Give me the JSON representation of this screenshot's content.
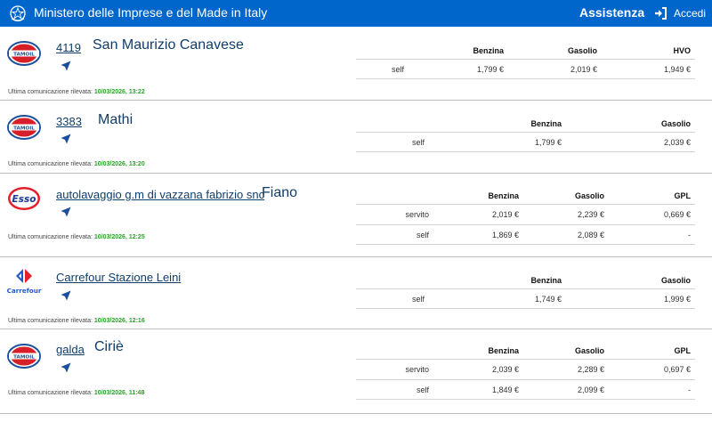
{
  "header": {
    "title": "Ministero delle Imprese e del Made in Italy",
    "help_label": "Assistenza",
    "login_label": "Accedi",
    "emblem_icon": "italian-republic-emblem-icon",
    "login_icon": "sign-in-icon"
  },
  "colors": {
    "header_bg": "#0066cc",
    "link_text": "#0f3d6b",
    "timestamp": "#2ca02c"
  },
  "stations": [
    {
      "brand": "tamoil",
      "code": "4119",
      "city": "San Maurizio Canavese",
      "fuels": [
        "Benzina",
        "Gasolio",
        "HVO"
      ],
      "rows": [
        {
          "service": "self",
          "prices": [
            "1,799 €",
            "2,019 €",
            "1,949 €"
          ]
        }
      ],
      "last_comm_label": "Ultima comunicazione rilevata:",
      "last_comm_time": "10/03/2026, 13:22"
    },
    {
      "brand": "tamoil",
      "code": "3383",
      "city": "Mathi",
      "fuels": [
        "Benzina",
        "Gasolio"
      ],
      "rows": [
        {
          "service": "self",
          "prices": [
            "1,799 €",
            "2,039 €"
          ]
        }
      ],
      "last_comm_label": "Ultima comunicazione rilevata:",
      "last_comm_time": "10/03/2026, 13:20"
    },
    {
      "brand": "esso",
      "code": "autolavaggio g.m di vazzana fabrizio snc",
      "city": "Fiano",
      "fuels": [
        "Benzina",
        "Gasolio",
        "GPL"
      ],
      "rows": [
        {
          "service": "servito",
          "prices": [
            "2,019 €",
            "2,239 €",
            "0,669 €"
          ]
        },
        {
          "service": "self",
          "prices": [
            "1,869 €",
            "2,089 €",
            "-"
          ]
        }
      ],
      "last_comm_label": "Ultima comunicazione rilevata:",
      "last_comm_time": "10/03/2026, 12:25"
    },
    {
      "brand": "carrefour",
      "code": "Carrefour Stazione Leini",
      "city": "",
      "fuels": [
        "Benzina",
        "Gasolio"
      ],
      "rows": [
        {
          "service": "self",
          "prices": [
            "1,749 €",
            "1,999 €"
          ]
        }
      ],
      "last_comm_label": "Ultima comunicazione rilevata:",
      "last_comm_time": "10/03/2026, 12:16"
    },
    {
      "brand": "tamoil",
      "code": "galda",
      "city": "Ciriè",
      "fuels": [
        "Benzina",
        "Gasolio",
        "GPL"
      ],
      "rows": [
        {
          "service": "servito",
          "prices": [
            "2,039 €",
            "2,289 €",
            "0,697 €"
          ]
        },
        {
          "service": "self",
          "prices": [
            "1,849 €",
            "2,099 €",
            "-"
          ]
        }
      ],
      "last_comm_label": "Ultima comunicazione rilevata:",
      "last_comm_time": "10/03/2026, 11:48"
    }
  ],
  "brand_logos": {
    "tamoil": {
      "text": "TAMOIL",
      "icon": "tamoil-logo-icon"
    },
    "esso": {
      "text": "Esso",
      "icon": "esso-logo-icon"
    },
    "carrefour": {
      "text": "Carrefour",
      "icon": "carrefour-logo-icon"
    }
  }
}
